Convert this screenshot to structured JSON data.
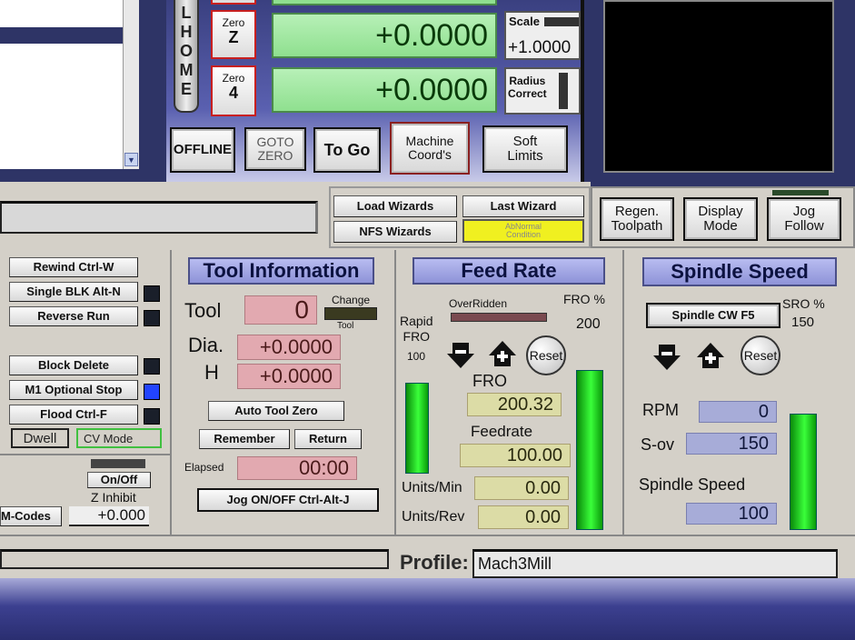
{
  "dro_panel": {
    "home_label": "L\nH\nO\nM\nE",
    "zero_z": {
      "top": "Zero",
      "axis": "Z"
    },
    "zero_4": {
      "top": "Zero",
      "axis": "4"
    },
    "z_value": "+0.0000",
    "a_value": "+0.0000",
    "scale_label": "Scale",
    "scale_value": "+1.0000",
    "radius_correct": "Radius\nCorrect",
    "offline": "OFFLINE",
    "goto_zero": "GOTO\nZERO",
    "to_go": "To Go",
    "machine_coords": "Machine\nCoord's",
    "soft_limits": "Soft\nLimits"
  },
  "wizards": {
    "load": "Load Wizards",
    "last": "Last Wizard",
    "nfs": "NFS Wizards",
    "abnormal": "AbNormal\nCondition"
  },
  "toolpath_buttons": {
    "regen": "Regen.\nToolpath",
    "display_mode": "Display\nMode",
    "jog_follow": "Jog\nFollow"
  },
  "program_controls": {
    "rewind": "Rewind Ctrl-W",
    "single_blk": "Single BLK Alt-N",
    "reverse_run": "Reverse Run",
    "block_delete": "Block Delete",
    "m1_optional": "M1 Optional Stop",
    "flood": "Flood Ctrl-F",
    "dwell": "Dwell",
    "cv_mode": "CV Mode",
    "on_off": "On/Off",
    "z_inhibit": "Z Inhibit",
    "m_codes": "M-Codes",
    "z_inhibit_value": "+0.000"
  },
  "tool_info": {
    "title": "Tool Information",
    "tool_label": "Tool",
    "tool_value": "0",
    "change_label": "Change",
    "change_sub": "Tool",
    "dia_label": "Dia.",
    "dia_value": "+0.0000",
    "h_label": "H",
    "h_value": "+0.0000",
    "auto_tool_zero": "Auto Tool Zero",
    "remember": "Remember",
    "return": "Return",
    "elapsed_label": "Elapsed",
    "elapsed_value": "00:00",
    "jog_onoff": "Jog ON/OFF Ctrl-Alt-J"
  },
  "feed_rate": {
    "title": "Feed Rate",
    "overridden": "OverRidden",
    "fro_pct_label": "FRO %",
    "fro_pct_value": "200",
    "rapid_fro_label": "Rapid\nFRO",
    "rapid_fro_value": "100",
    "reset": "Reset",
    "fro_label": "FRO",
    "fro_value": "200.32",
    "feedrate_label": "Feedrate",
    "feedrate_value": "100.00",
    "units_min_label": "Units/Min",
    "units_min_value": "0.00",
    "units_rev_label": "Units/Rev",
    "units_rev_value": "0.00",
    "rapid_level": 0.85,
    "fro_level": 1.0
  },
  "spindle": {
    "title": "Spindle Speed",
    "cw_button": "Spindle CW F5",
    "sro_label": "SRO %",
    "sro_value": "150",
    "reset": "Reset",
    "rpm_label": "RPM",
    "rpm_value": "0",
    "sov_label": "S-ov",
    "sov_value": "150",
    "speed_label": "Spindle Speed",
    "speed_value": "100",
    "level": 1.0
  },
  "status": {
    "profile_label": "Profile:",
    "profile_value": "Mach3Mill"
  }
}
